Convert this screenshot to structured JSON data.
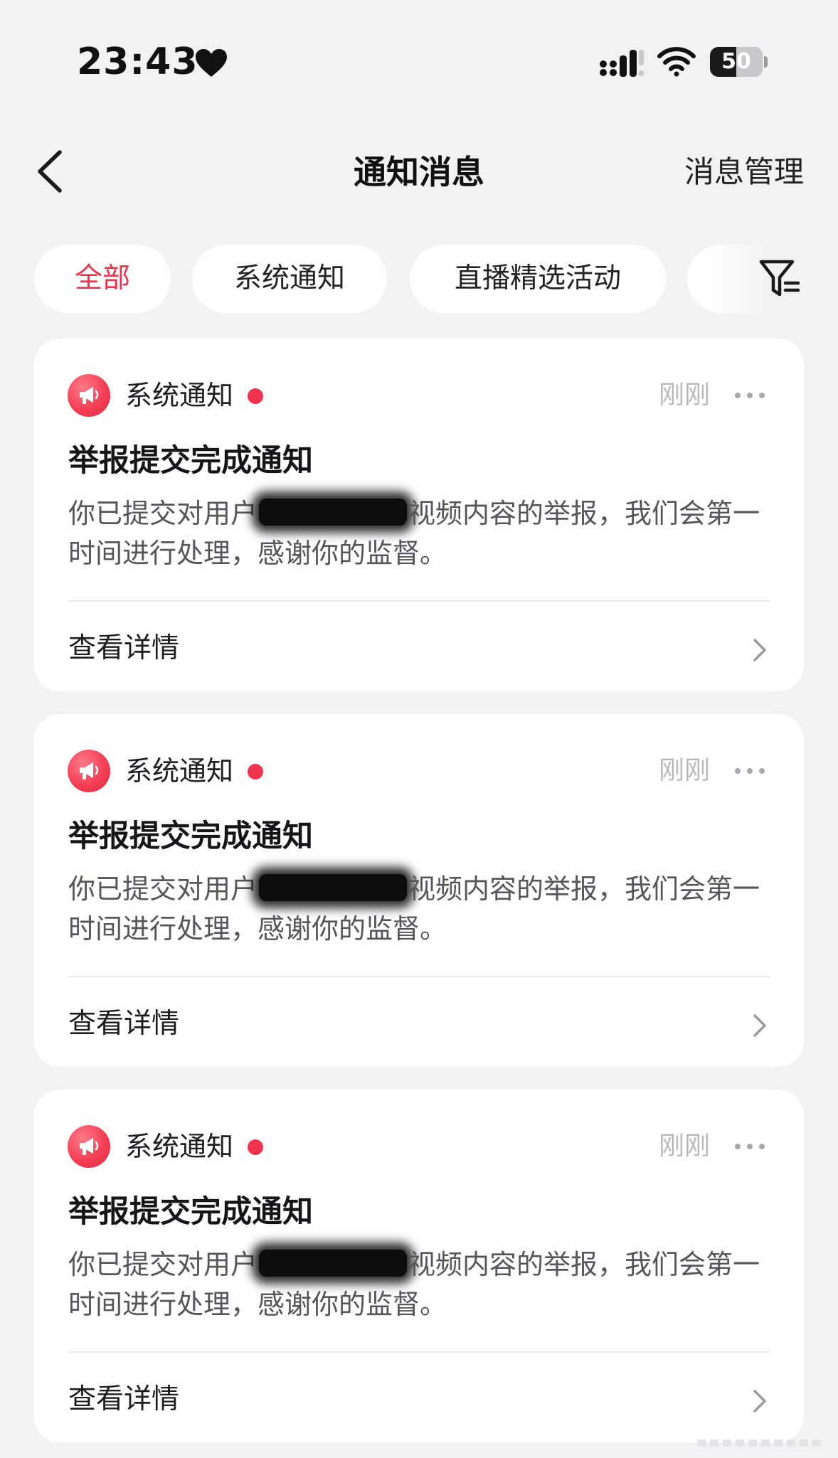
{
  "status_bar": {
    "time": "23:43",
    "battery_level": "50",
    "battery_fraction": 0.5
  },
  "nav": {
    "title": "通知消息",
    "manage_label": "消息管理"
  },
  "tabs": [
    {
      "label": "全部",
      "active": true
    },
    {
      "label": "系统通知",
      "active": false
    },
    {
      "label": "直播精选活动",
      "active": false
    }
  ],
  "notifications": [
    {
      "source": "系统通知",
      "time": "刚刚",
      "title": "举报提交完成通知",
      "body_prefix": "你已提交对用户",
      "body_suffix": "视频内容的举报，我们会第一时间进行处理，感谢你的监督。",
      "link": "查看详情"
    },
    {
      "source": "系统通知",
      "time": "刚刚",
      "title": "举报提交完成通知",
      "body_prefix": "你已提交对用户",
      "body_suffix": "视频内容的举报，我们会第一时间进行处理，感谢你的监督。",
      "link": "查看详情"
    },
    {
      "source": "系统通知",
      "time": "刚刚",
      "title": "举报提交完成通知",
      "body_prefix": "你已提交对用户",
      "body_suffix": "视频内容的举报，我们会第一时间进行处理，感谢你的监督。",
      "link": "查看详情"
    }
  ],
  "colors": {
    "accent": "#e8344d",
    "unread_dot": "#f0334f",
    "background": "#f2f2f4",
    "card": "#ffffff"
  },
  "icons": {
    "back": "chevron-left-icon",
    "filter": "filter-icon",
    "source": "megaphone-icon",
    "more": "more-dots-icon",
    "link_arrow": "chevron-right-icon"
  }
}
